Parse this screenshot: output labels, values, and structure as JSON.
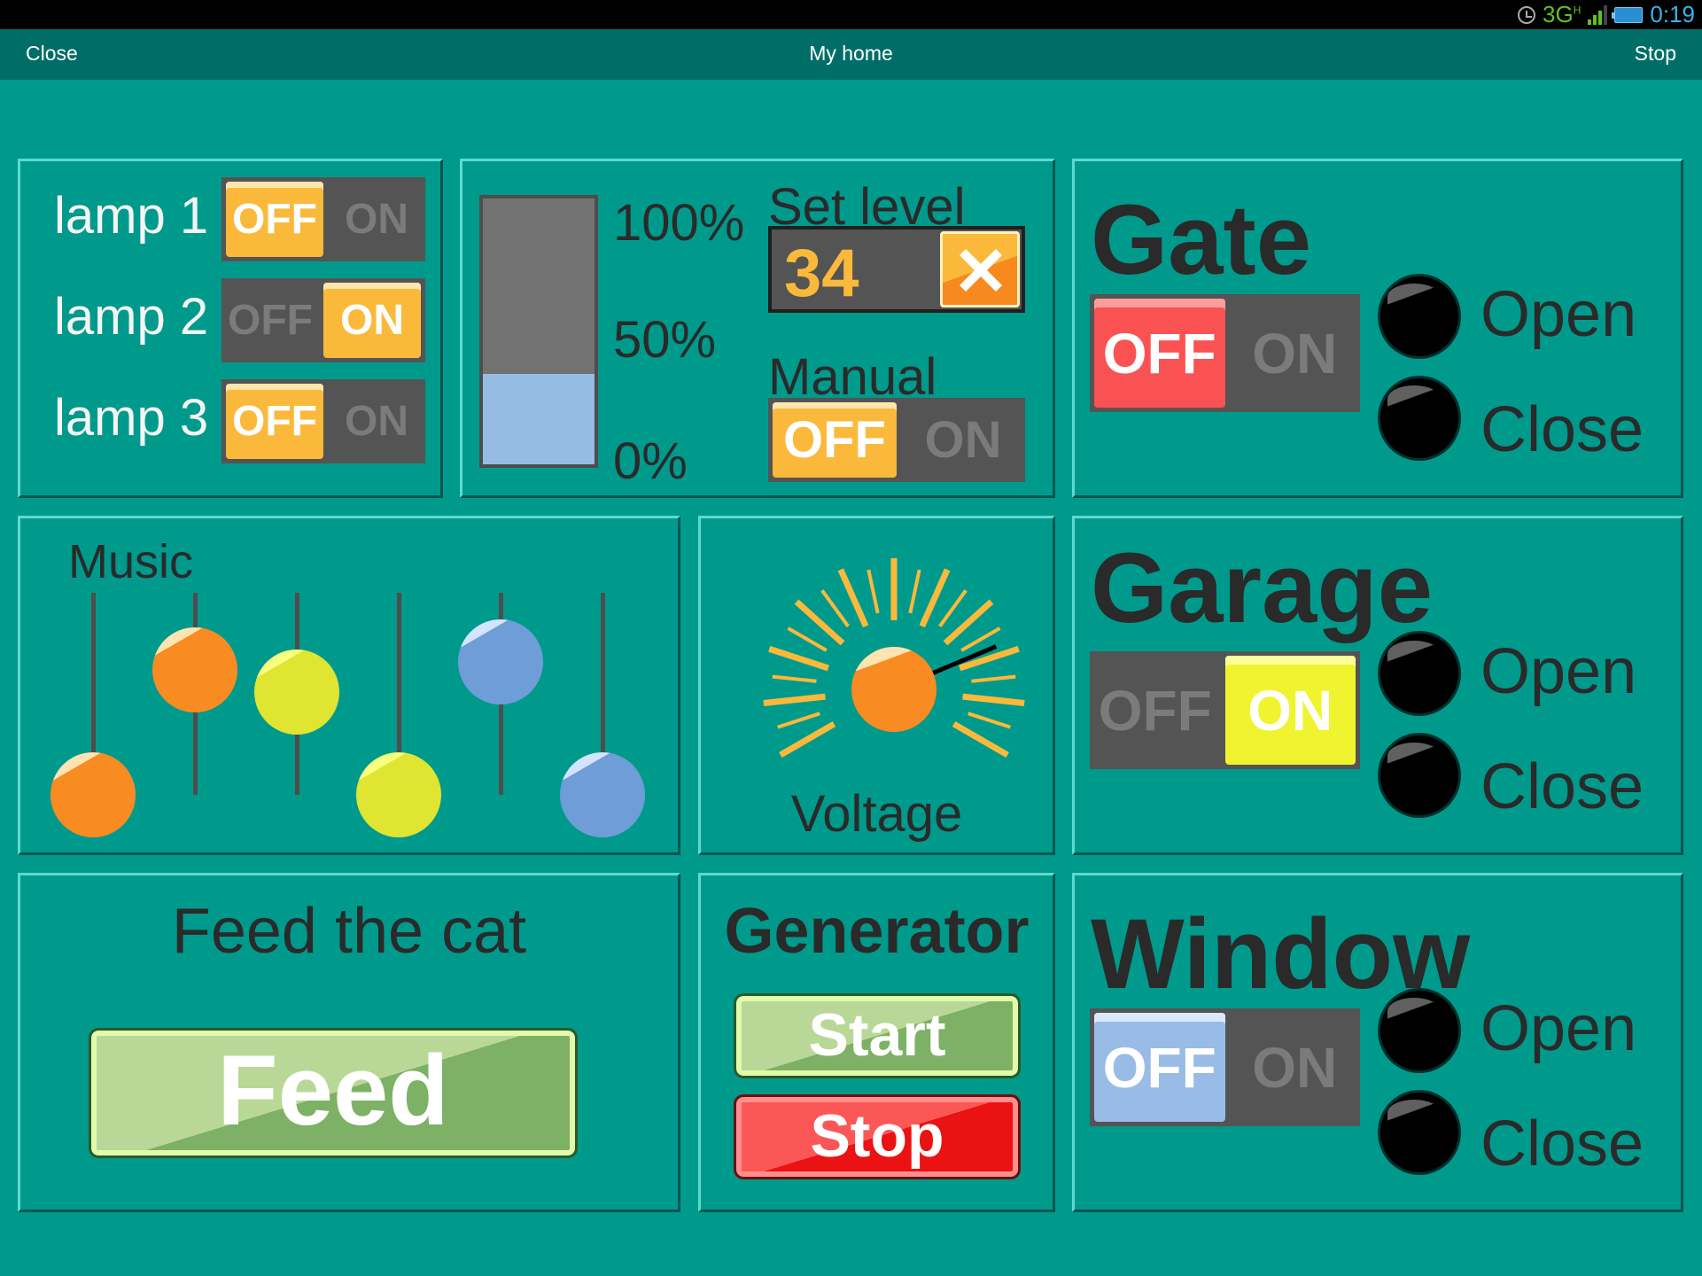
{
  "status_bar": {
    "network": "3G",
    "network_sub": "H",
    "time": "0:19"
  },
  "title_bar": {
    "left_button": "Close",
    "title": "My home",
    "right_button": "Stop"
  },
  "lamps": [
    {
      "label": "lamp 1",
      "off_label": "OFF",
      "on_label": "ON",
      "state": "off"
    },
    {
      "label": "lamp 2",
      "off_label": "OFF",
      "on_label": "ON",
      "state": "on"
    },
    {
      "label": "lamp 3",
      "off_label": "OFF",
      "on_label": "ON",
      "state": "off"
    }
  ],
  "level": {
    "ticks": [
      "100%",
      "50%",
      "0%"
    ],
    "fill_percent": 34,
    "set_level_label": "Set level",
    "set_level_value": "34",
    "manual_label": "Manual",
    "manual_off": "OFF",
    "manual_on": "ON",
    "manual_state": "off"
  },
  "gate": {
    "title": "Gate",
    "off_label": "OFF",
    "on_label": "ON",
    "state": "off",
    "open_label": "Open",
    "close_label": "Close"
  },
  "garage": {
    "title": "Garage",
    "off_label": "OFF",
    "on_label": "ON",
    "state": "on",
    "open_label": "Open",
    "close_label": "Close"
  },
  "window": {
    "title": "Window",
    "off_label": "OFF",
    "on_label": "ON",
    "state": "off",
    "open_label": "Open",
    "close_label": "Close"
  },
  "music": {
    "title": "Music",
    "sliders": [
      {
        "color": "orange",
        "value": 0.0
      },
      {
        "color": "orange",
        "value": 0.62
      },
      {
        "color": "yellow",
        "value": 0.51
      },
      {
        "color": "yellow",
        "value": 0.0
      },
      {
        "color": "blue",
        "value": 0.66
      },
      {
        "color": "blue",
        "value": 0.0
      }
    ]
  },
  "voltage": {
    "label": "Voltage",
    "value": 0.78
  },
  "feed": {
    "title": "Feed the cat",
    "button": "Feed"
  },
  "generator": {
    "title": "Generator",
    "start": "Start",
    "stop": "Stop"
  }
}
